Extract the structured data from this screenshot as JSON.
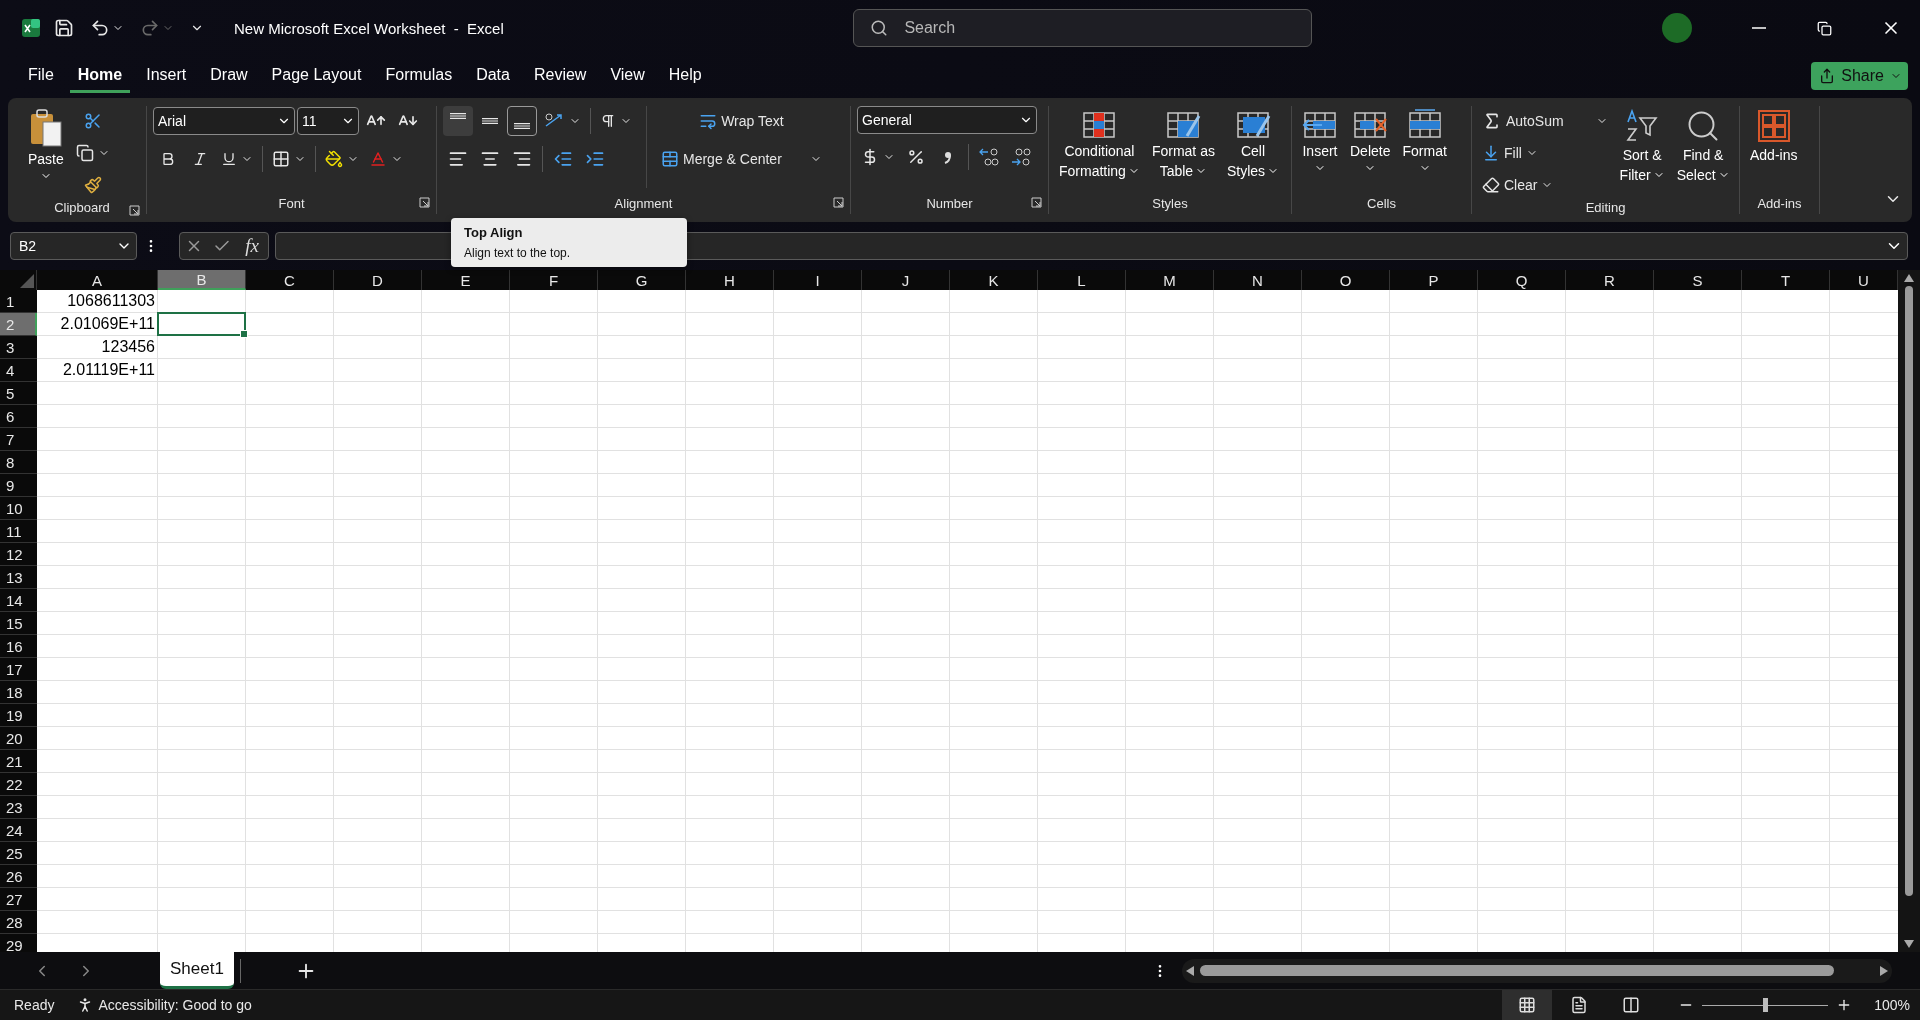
{
  "title_bar": {
    "title": "New Microsoft Excel Worksheet  -  Excel",
    "search_placeholder": "Search",
    "redo_disabled": true
  },
  "menu_tabs": [
    {
      "label": "File",
      "selected": false
    },
    {
      "label": "Home",
      "selected": true
    },
    {
      "label": "Insert",
      "selected": false
    },
    {
      "label": "Draw",
      "selected": false
    },
    {
      "label": "Page Layout",
      "selected": false
    },
    {
      "label": "Formulas",
      "selected": false
    },
    {
      "label": "Data",
      "selected": false
    },
    {
      "label": "Review",
      "selected": false
    },
    {
      "label": "View",
      "selected": false
    },
    {
      "label": "Help",
      "selected": false
    }
  ],
  "share_button": "Share",
  "ribbon": {
    "clipboard": {
      "paste": "Paste",
      "label": "Clipboard"
    },
    "font": {
      "name": "Arial",
      "size": "11",
      "label": "Font"
    },
    "alignment": {
      "vertical": [
        {
          "kind": "top",
          "hovered": true,
          "selected": false
        },
        {
          "kind": "middle",
          "hovered": false,
          "selected": false
        },
        {
          "kind": "bottom",
          "hovered": false,
          "selected": true
        }
      ],
      "wrap_text": "Wrap Text",
      "merge": "Merge & Center",
      "label": "Alignment"
    },
    "number": {
      "format": "General",
      "label": "Number"
    },
    "styles": {
      "buttons": [
        {
          "kind": "conditional",
          "lines": [
            "Conditional",
            "Formatting"
          ]
        },
        {
          "kind": "table",
          "lines": [
            "Format as",
            "Table"
          ]
        },
        {
          "kind": "cell",
          "lines": [
            "Cell",
            "Styles"
          ]
        }
      ],
      "label": "Styles"
    },
    "cells": {
      "buttons": [
        {
          "kind": "insert",
          "lines": [
            "Insert"
          ]
        },
        {
          "kind": "delete",
          "lines": [
            "Delete"
          ]
        },
        {
          "kind": "format",
          "lines": [
            "Format"
          ]
        }
      ],
      "label": "Cells"
    },
    "editing": {
      "autosum": "AutoSum",
      "fill": "Fill",
      "clear": "Clear",
      "buttons": [
        {
          "kind": "sort",
          "lines": [
            "Sort &",
            "Filter"
          ]
        },
        {
          "kind": "find",
          "lines": [
            "Find &",
            "Select"
          ]
        }
      ],
      "label": "Editing"
    },
    "addins": {
      "button": "Add-ins",
      "label": "Add-ins"
    }
  },
  "tooltip": {
    "title": "Top Align",
    "text": "Align text to the top."
  },
  "formula_bar": {
    "name_box": "B2",
    "function_button": "fx"
  },
  "columns": [
    {
      "label": "A",
      "selected": false
    },
    {
      "label": "B",
      "selected": true
    },
    {
      "label": "C",
      "selected": false
    },
    {
      "label": "D",
      "selected": false
    },
    {
      "label": "E",
      "selected": false
    },
    {
      "label": "F",
      "selected": false
    },
    {
      "label": "G",
      "selected": false
    },
    {
      "label": "H",
      "selected": false
    },
    {
      "label": "I",
      "selected": false
    },
    {
      "label": "J",
      "selected": false
    },
    {
      "label": "K",
      "selected": false
    },
    {
      "label": "L",
      "selected": false
    },
    {
      "label": "M",
      "selected": false
    },
    {
      "label": "N",
      "selected": false
    },
    {
      "label": "O",
      "selected": false
    },
    {
      "label": "P",
      "selected": false
    },
    {
      "label": "Q",
      "selected": false
    },
    {
      "label": "R",
      "selected": false
    },
    {
      "label": "S",
      "selected": false
    },
    {
      "label": "T",
      "selected": false
    },
    {
      "label": "U",
      "selected": false
    }
  ],
  "rows": [
    {
      "label": "1",
      "selected": false,
      "column_a": "1068611303"
    },
    {
      "label": "2",
      "selected": true,
      "column_a": "2.01069E+11"
    },
    {
      "label": "3",
      "selected": false,
      "column_a": "123456"
    },
    {
      "label": "4",
      "selected": false,
      "column_a": "2.01119E+11"
    },
    {
      "label": "5",
      "selected": false
    },
    {
      "label": "6",
      "selected": false
    },
    {
      "label": "7",
      "selected": false
    },
    {
      "label": "8",
      "selected": false
    },
    {
      "label": "9",
      "selected": false
    },
    {
      "label": "10",
      "selected": false
    },
    {
      "label": "11",
      "selected": false
    },
    {
      "label": "12",
      "selected": false
    },
    {
      "label": "13",
      "selected": false
    },
    {
      "label": "14",
      "selected": false
    },
    {
      "label": "15",
      "selected": false
    },
    {
      "label": "16",
      "selected": false
    },
    {
      "label": "17",
      "selected": false
    },
    {
      "label": "18",
      "selected": false
    },
    {
      "label": "19",
      "selected": false
    },
    {
      "label": "20",
      "selected": false
    },
    {
      "label": "21",
      "selected": false
    },
    {
      "label": "22",
      "selected": false
    },
    {
      "label": "23",
      "selected": false
    },
    {
      "label": "24",
      "selected": false
    },
    {
      "label": "25",
      "selected": false
    },
    {
      "label": "26",
      "selected": false
    },
    {
      "label": "27",
      "selected": false
    },
    {
      "label": "28",
      "selected": false
    },
    {
      "label": "29",
      "selected": false
    }
  ],
  "sheet_tabs": [
    {
      "label": "Sheet1",
      "selected": true
    }
  ],
  "status_bar": {
    "ready": "Ready",
    "accessibility": "Accessibility: Good to go",
    "views": [
      {
        "kind": "normal",
        "selected": true
      },
      {
        "kind": "page_layout",
        "selected": false
      },
      {
        "kind": "page_break",
        "selected": false
      }
    ],
    "zoom": {
      "level": 0.5,
      "reading": "100%"
    }
  }
}
